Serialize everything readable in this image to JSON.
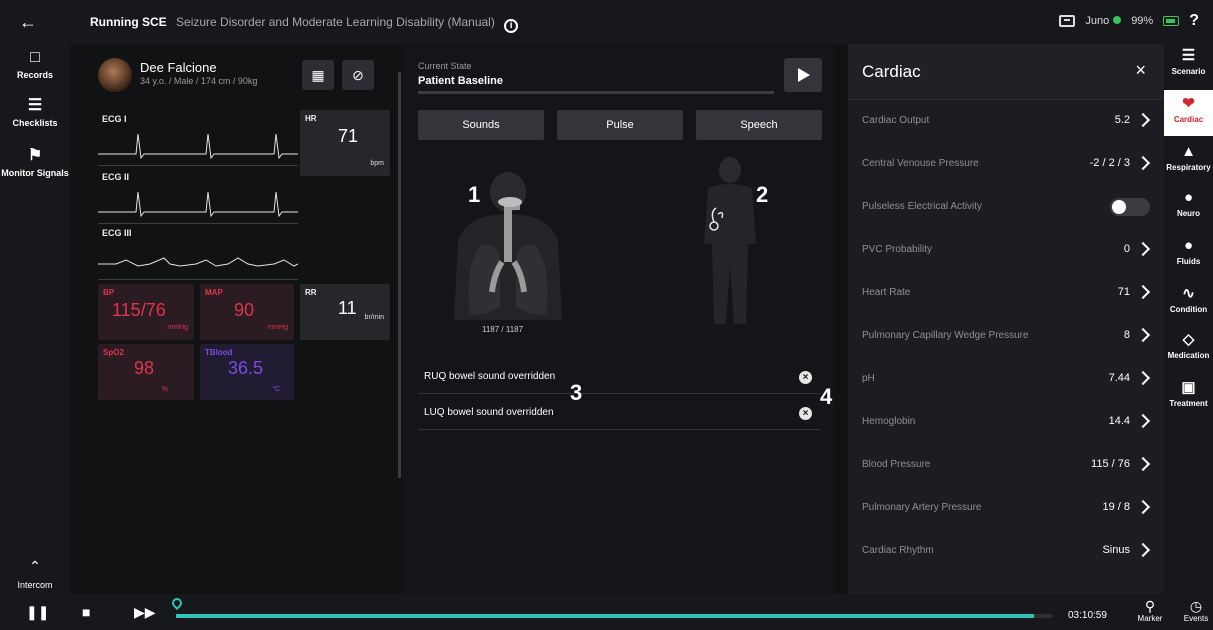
{
  "topbar": {
    "title_strong": "Running SCE",
    "title_sub": "Seizure Disorder and Moderate Learning Disability (Manual)",
    "info_icon": "i",
    "user": "Juno",
    "battery": "99%",
    "help": "?"
  },
  "leftnav": {
    "records": "Records",
    "checklists": "Checklists",
    "monitor_signals": "Monitor Signals",
    "intercom": "Intercom"
  },
  "patient": {
    "name": "Dee Falcione",
    "meta": "34 y.o. / Male / 174 cm / 90kg"
  },
  "ecg": {
    "lead1": "ECG I",
    "lead2": "ECG II",
    "lead3": "ECG III"
  },
  "vitals": {
    "hr_label": "HR",
    "hr_value": "71",
    "hr_unit": "bpm",
    "rr_label": "RR",
    "rr_value": "11",
    "rr_unit": "br/min",
    "bp_label": "BP",
    "bp_value": "115/76",
    "bp_unit": "mmHg",
    "map_label": "MAP",
    "map_value": "90",
    "map_unit": "mmHg",
    "spo2_label": "SpO2",
    "spo2_value": "98",
    "spo2_unit": "%",
    "tblood_label": "TBlood",
    "tblood_value": "36.5",
    "tblood_unit": "°C"
  },
  "center": {
    "current_state_label": "Current State",
    "current_state_value": "Patient Baseline",
    "tabs": [
      "Sounds",
      "Pulse",
      "Speech"
    ],
    "counter": "1187 / 1187",
    "callouts": [
      "1",
      "2",
      "3",
      "4"
    ],
    "overrides": [
      "RUQ bowel sound overridden",
      "LUQ bowel sound overridden"
    ]
  },
  "cardiac": {
    "title": "Cardiac",
    "params": [
      {
        "label": "Cardiac Output",
        "value": "5.2"
      },
      {
        "label": "Central Venouse Pressure",
        "value": "-2 / 2 / 3"
      },
      {
        "label": "Pulseless Electrical Activity",
        "value": ""
      },
      {
        "label": "PVC Probability",
        "value": "0"
      },
      {
        "label": "Heart Rate",
        "value": "71"
      },
      {
        "label": "Pulmonary Capillary Wedge Pressure",
        "value": "8"
      },
      {
        "label": "pH",
        "value": "7.44"
      },
      {
        "label": "Hemoglobin",
        "value": "14.4"
      },
      {
        "label": "Blood Pressure",
        "value": "115 / 76"
      },
      {
        "label": "Pulmonary Artery Pressure",
        "value": "19 / 8"
      },
      {
        "label": "Cardiac Rhythm",
        "value": "Sinus"
      }
    ]
  },
  "rightnav": {
    "items": [
      "Scenario",
      "Cardiac",
      "Respiratory",
      "Neuro",
      "Fluids",
      "Condition",
      "Medication",
      "Treatment"
    ]
  },
  "timeline": {
    "progress": 0.98,
    "time": "03:10:59",
    "marker": "Marker",
    "events": "Events"
  },
  "colors": {
    "bp": "#e0344a",
    "map": "#e0344a",
    "spo2": "#e0344a",
    "tblood": "#7b4ae0",
    "accent": "#2ec4b6",
    "active_tab": "#d1262f"
  }
}
